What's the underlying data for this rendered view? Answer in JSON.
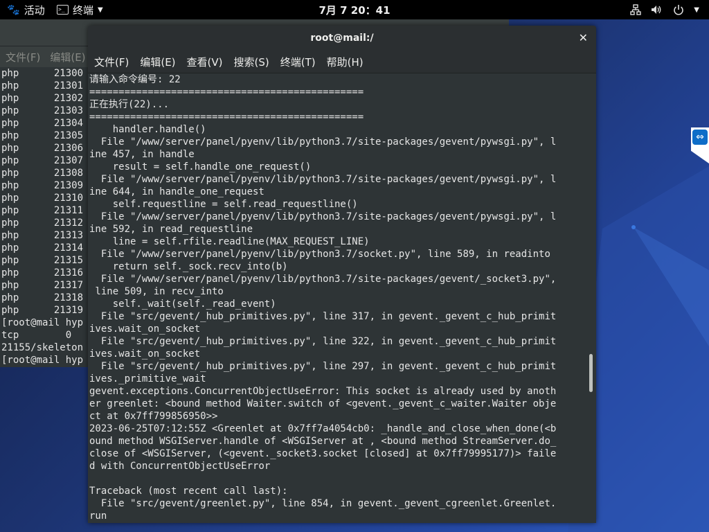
{
  "topbar": {
    "activities_label": "活动",
    "app_name": "终端",
    "clock": "7月 7 20：41"
  },
  "bg_window": {
    "menu": [
      "文件(F)",
      "编辑(E)"
    ],
    "lines": [
      "php      21300",
      "php      21301",
      "php      21302",
      "php      21303",
      "php      21304",
      "php      21305",
      "php      21306",
      "php      21307",
      "php      21308",
      "php      21309",
      "php      21310",
      "php      21311",
      "php      21312",
      "php      21313",
      "php      21314",
      "php      21315",
      "php      21316",
      "php      21317",
      "php      21318",
      "php      21319",
      "[root@mail hyp",
      "tcp        0",
      "21155/skeleton",
      "[root@mail hyp"
    ]
  },
  "fg_window": {
    "title": "root@mail:/",
    "menu": [
      "文件(F)",
      "编辑(E)",
      "查看(V)",
      "搜索(S)",
      "终端(T)",
      "帮助(H)"
    ],
    "lines": [
      "请输入命令编号: 22",
      "===============================================",
      "正在执行(22)...",
      "===============================================",
      "    handler.handle()",
      "  File \"/www/server/panel/pyenv/lib/python3.7/site-packages/gevent/pywsgi.py\", l",
      "ine 457, in handle",
      "    result = self.handle_one_request()",
      "  File \"/www/server/panel/pyenv/lib/python3.7/site-packages/gevent/pywsgi.py\", l",
      "ine 644, in handle_one_request",
      "    self.requestline = self.read_requestline()",
      "  File \"/www/server/panel/pyenv/lib/python3.7/site-packages/gevent/pywsgi.py\", l",
      "ine 592, in read_requestline",
      "    line = self.rfile.readline(MAX_REQUEST_LINE)",
      "  File \"/www/server/panel/pyenv/lib/python3.7/socket.py\", line 589, in readinto",
      "    return self._sock.recv_into(b)",
      "  File \"/www/server/panel/pyenv/lib/python3.7/site-packages/gevent/_socket3.py\",",
      " line 509, in recv_into",
      "    self._wait(self._read_event)",
      "  File \"src/gevent/_hub_primitives.py\", line 317, in gevent._gevent_c_hub_primit",
      "ives.wait_on_socket",
      "  File \"src/gevent/_hub_primitives.py\", line 322, in gevent._gevent_c_hub_primit",
      "ives.wait_on_socket",
      "  File \"src/gevent/_hub_primitives.py\", line 297, in gevent._gevent_c_hub_primit",
      "ives._primitive_wait",
      "gevent.exceptions.ConcurrentObjectUseError: This socket is already used by anoth",
      "er greenlet: <bound method Waiter.switch of <gevent._gevent_c_waiter.Waiter obje",
      "ct at 0x7ff799856950>>",
      "2023-06-25T07:12:55Z <Greenlet at 0x7ff7a4054cb0: _handle_and_close_when_done(<b",
      "ound method WSGIServer.handle of <WSGIServer at , <bound method StreamServer.do_",
      "close of <WSGIServer, (<gevent._socket3.socket [closed] at 0x7ff79995177)> faile",
      "d with ConcurrentObjectUseError",
      "",
      "Traceback (most recent call last):",
      "  File \"src/gevent/greenlet.py\", line 854, in gevent._gevent_cgreenlet.Greenlet.",
      "run"
    ]
  },
  "icons": {
    "activities": "gnome-foot-icon",
    "terminal": "terminal-icon",
    "network": "network-icon",
    "volume": "volume-icon",
    "power": "power-icon",
    "remote": "teamviewer-icon"
  },
  "colors": {
    "terminal_bg": "#2e3436",
    "titlebar_bg": "#2b2f31",
    "text": "#e6e6e6",
    "topbar_bg": "#000000"
  }
}
